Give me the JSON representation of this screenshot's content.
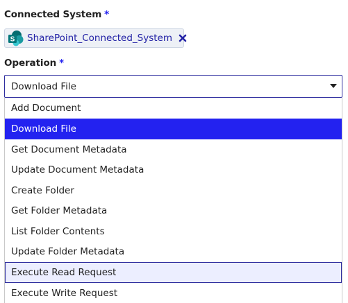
{
  "connected_system": {
    "label": "Connected System",
    "required_marker": "*",
    "value": "SharePoint_Connected_System",
    "icon": "sharepoint-icon"
  },
  "operation": {
    "label": "Operation",
    "required_marker": "*",
    "selected": "Download File",
    "options": [
      "Add Document",
      "Download File",
      "Get Document Metadata",
      "Update Document Metadata",
      "Create Folder",
      "Get Folder Metadata",
      "List Folder Contents",
      "Update Folder Metadata",
      "Execute Read Request",
      "Execute Write Request"
    ],
    "highlighted_option": "Execute Read Request"
  },
  "colors": {
    "accent": "#2322f0",
    "border_active": "#2f2e9f",
    "chip_text": "#2322a6",
    "hover_bg": "#eceeff"
  }
}
